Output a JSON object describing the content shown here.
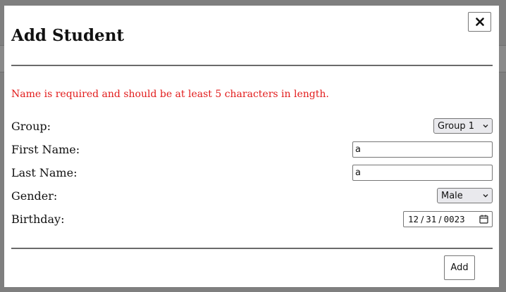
{
  "dialog": {
    "title": "Add Student",
    "close_icon": "close-icon",
    "error_message": "Name is required and should be at least 5 characters in length."
  },
  "form": {
    "group": {
      "label": "Group:",
      "selected": "Group 1"
    },
    "first_name": {
      "label": "First Name:",
      "value": "a"
    },
    "last_name": {
      "label": "Last Name:",
      "value": "a"
    },
    "gender": {
      "label": "Gender:",
      "selected": "Male"
    },
    "birthday": {
      "label": "Birthday:",
      "month": "12",
      "day": "31",
      "year": "0023",
      "separator": "/",
      "calendar_icon": "calendar-icon"
    }
  },
  "actions": {
    "add_label": "Add"
  },
  "colors": {
    "error": "#e21b1b",
    "overlay": "#7f7f7f",
    "select_bg": "#e9e9ed"
  }
}
